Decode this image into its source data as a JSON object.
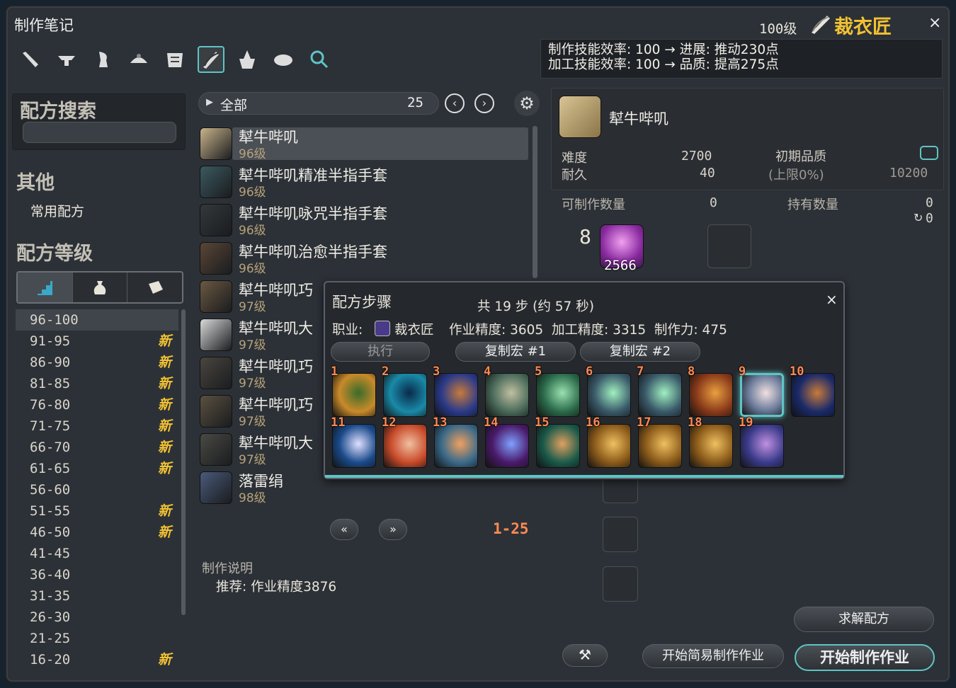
{
  "window": {
    "title": "制作笔记",
    "close": "×"
  },
  "job": {
    "level": "100级",
    "name": "裁衣匠"
  },
  "efficiency": {
    "line1": "制作技能效率: 100 → 进展: 推动230点",
    "line2": "加工技能效率: 100 → 品质: 提高275点"
  },
  "toolbar_icons": [
    "carpenter-icon",
    "blacksmith-icon",
    "armorer-icon",
    "goldsmith-icon",
    "leatherworker-icon",
    "weaver-icon",
    "alchemist-icon",
    "culinarian-icon",
    "search-icon"
  ],
  "left": {
    "search_title": "配方搜索",
    "search_placeholder": "",
    "other_title": "其他",
    "common_recipes": "常用配方",
    "level_title": "配方等级",
    "level_tab_icons": [
      "stairs-icon",
      "bag-icon",
      "book-icon"
    ],
    "levels": [
      {
        "label": "96-100",
        "new": ""
      },
      {
        "label": "91-95",
        "new": "新"
      },
      {
        "label": "86-90",
        "new": "新"
      },
      {
        "label": "81-85",
        "new": "新"
      },
      {
        "label": "76-80",
        "new": "新"
      },
      {
        "label": "71-75",
        "new": "新"
      },
      {
        "label": "66-70",
        "new": "新"
      },
      {
        "label": "61-65",
        "new": "新"
      },
      {
        "label": "56-60",
        "new": ""
      },
      {
        "label": "51-55",
        "new": "新"
      },
      {
        "label": "46-50",
        "new": "新"
      },
      {
        "label": "41-45",
        "new": ""
      },
      {
        "label": "36-40",
        "new": ""
      },
      {
        "label": "31-35",
        "new": ""
      },
      {
        "label": "26-30",
        "new": ""
      },
      {
        "label": "21-25",
        "new": ""
      },
      {
        "label": "16-20",
        "new": "新"
      }
    ]
  },
  "list": {
    "filter": "全部",
    "count": "25",
    "items": [
      {
        "name": "犎牛哔叽",
        "level": "96级",
        "color": "#c9b48a"
      },
      {
        "name": "犎牛哔叽精准半指手套",
        "level": "96级",
        "color": "#3b5a5f"
      },
      {
        "name": "犎牛哔叽咏咒半指手套",
        "level": "96级",
        "color": "#34383b"
      },
      {
        "name": "犎牛哔叽治愈半指手套",
        "level": "96级",
        "color": "#5a4636"
      },
      {
        "name": "犎牛哔叽巧",
        "level": "97级",
        "color": "#6b5842"
      },
      {
        "name": "犎牛哔叽大",
        "level": "97级",
        "color": "#d9d9d9"
      },
      {
        "name": "犎牛哔叽巧",
        "level": "97级",
        "color": "#4a463f"
      },
      {
        "name": "犎牛哔叽巧",
        "level": "97级",
        "color": "#5a5040"
      },
      {
        "name": "犎牛哔叽大",
        "level": "97级",
        "color": "#4a4a44"
      },
      {
        "name": "落雷绢",
        "level": "98级",
        "color": "#4a5a7a"
      }
    ],
    "pager": "1-25"
  },
  "note": {
    "title": "制作说明",
    "recommend": "推荐: 作业精度3876"
  },
  "detail": {
    "name": "犎牛哔叽",
    "difficulty_label": "难度",
    "difficulty": "2700",
    "durability_label": "耐久",
    "durability": "40",
    "init_quality_label": "初期品质",
    "init_quality_sub": "(上限0%)",
    "quality": "10200",
    "craftable_label": "可制作数量",
    "craftable": "0",
    "owned_label": "持有数量",
    "owned": "0",
    "hq_owned": "0",
    "material_qty": "8",
    "material_owned": "2566"
  },
  "macro": {
    "title": "配方步骤",
    "summary": "共 19 步 (约 57 秒)",
    "job_label": "职业:",
    "job_name": "裁衣匠",
    "stats": "作业精度: 3605  加工精度: 3315  制作力: 475",
    "execute": "执行",
    "copy1": "复制宏 #1",
    "copy2": "复制宏 #2",
    "close": "×",
    "steps": [
      {
        "n": "1",
        "c1": "#c98a2a",
        "c2": "#3a6b2a"
      },
      {
        "n": "2",
        "c1": "#1a8aa8",
        "c2": "#0a2a4a"
      },
      {
        "n": "3",
        "c1": "#2a3a8a",
        "c2": "#c87a3a"
      },
      {
        "n": "4",
        "c1": "#4a6a5a",
        "c2": "#c0c0a0"
      },
      {
        "n": "5",
        "c1": "#2a6a4a",
        "c2": "#9ae0b0"
      },
      {
        "n": "6",
        "c1": "#3a5a6a",
        "c2": "#a0f0c0"
      },
      {
        "n": "7",
        "c1": "#3a5a6a",
        "c2": "#a0f0c0"
      },
      {
        "n": "8",
        "c1": "#8a3a1a",
        "c2": "#e8a040"
      },
      {
        "n": "9",
        "c1": "#6a7a9a",
        "c2": "#f0e0e0"
      },
      {
        "n": "10",
        "c1": "#1a2a6a",
        "c2": "#c87a3a"
      },
      {
        "n": "11",
        "c1": "#1a4a8a",
        "c2": "#e0e0ff"
      },
      {
        "n": "12",
        "c1": "#c84a2a",
        "c2": "#f0c0a0"
      },
      {
        "n": "13",
        "c1": "#3a6a8a",
        "c2": "#f0a060"
      },
      {
        "n": "14",
        "c1": "#4a1a6a",
        "c2": "#80a0ff"
      },
      {
        "n": "15",
        "c1": "#1a5a4a",
        "c2": "#e0a060"
      },
      {
        "n": "16",
        "c1": "#8a5a1a",
        "c2": "#f0c060"
      },
      {
        "n": "17",
        "c1": "#8a5a1a",
        "c2": "#f0c060"
      },
      {
        "n": "18",
        "c1": "#8a5a1a",
        "c2": "#f0c060"
      },
      {
        "n": "19",
        "c1": "#3a3a8a",
        "c2": "#c090e0"
      }
    ]
  },
  "buttons": {
    "solve": "求解配方",
    "quick_synth": "开始简易制作作业",
    "synth": "开始制作作业"
  },
  "colors": {
    "accent": "#5ec5c5",
    "gold": "#f2c232",
    "stepnum": "#ff8a52"
  }
}
